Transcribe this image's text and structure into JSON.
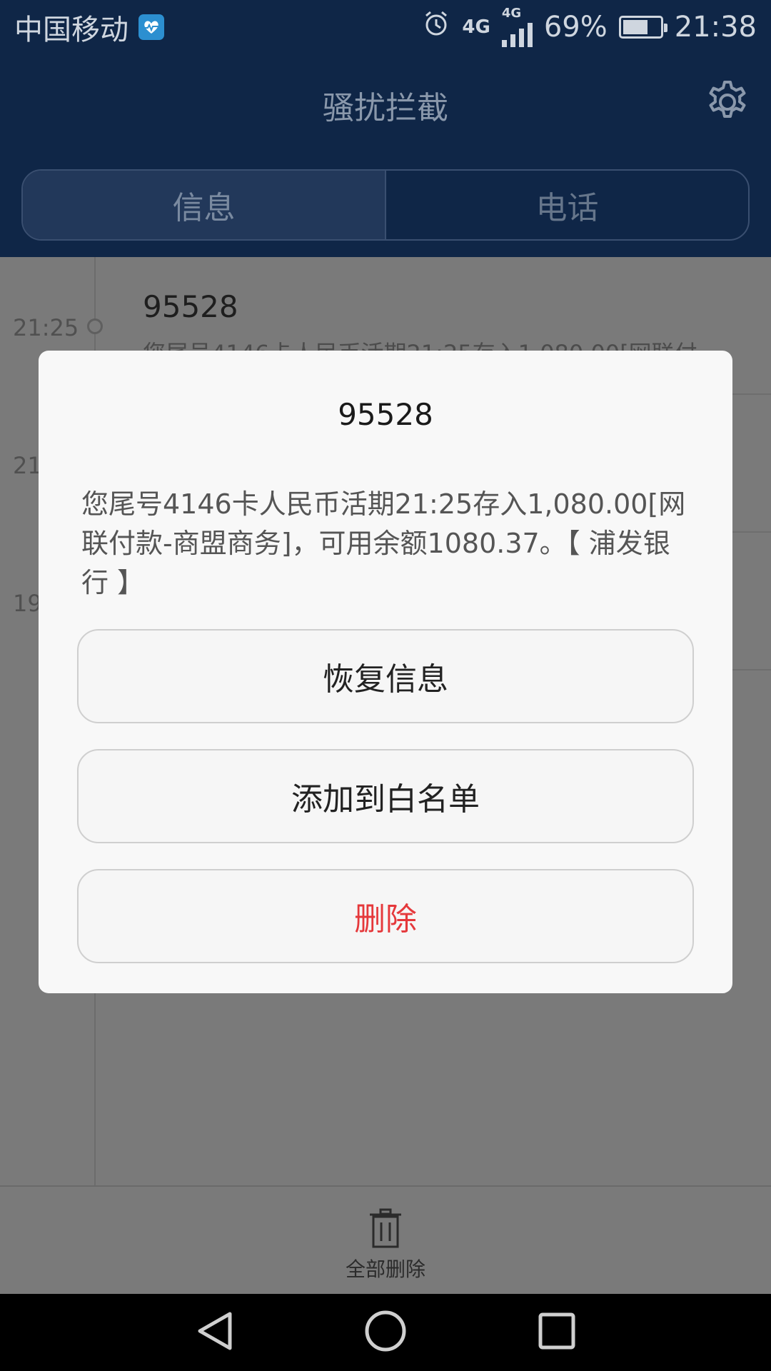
{
  "status_bar": {
    "carrier": "中国移动",
    "net_primary": "4G",
    "net_secondary": "4G",
    "battery_percent": "69%",
    "battery_level": 0.69,
    "time": "21:38"
  },
  "header": {
    "title": "骚扰拦截"
  },
  "tabs": [
    {
      "label": "信息",
      "active": true
    },
    {
      "label": "电话",
      "active": false
    }
  ],
  "messages": [
    {
      "time": "21:25",
      "sender": "95528",
      "preview": "您尾号4146卡人民币活期21:25存入1,080.00[网联付"
    },
    {
      "time": "21",
      "sender": "",
      "preview": ""
    },
    {
      "time": "19",
      "sender": "",
      "preview": ""
    }
  ],
  "dialog": {
    "title": "95528",
    "body": "您尾号4146卡人民币活期21:25存入1,080.00[网联付款-商盟商务]，可用余额1080.37。【 浦发银行 】",
    "buttons": {
      "restore": "恢复信息",
      "whitelist": "添加到白名单",
      "delete": "删除"
    }
  },
  "toolbar": {
    "delete_all": "全部删除"
  },
  "colors": {
    "header_bg": "#0f2647",
    "danger": "#e5383b"
  }
}
